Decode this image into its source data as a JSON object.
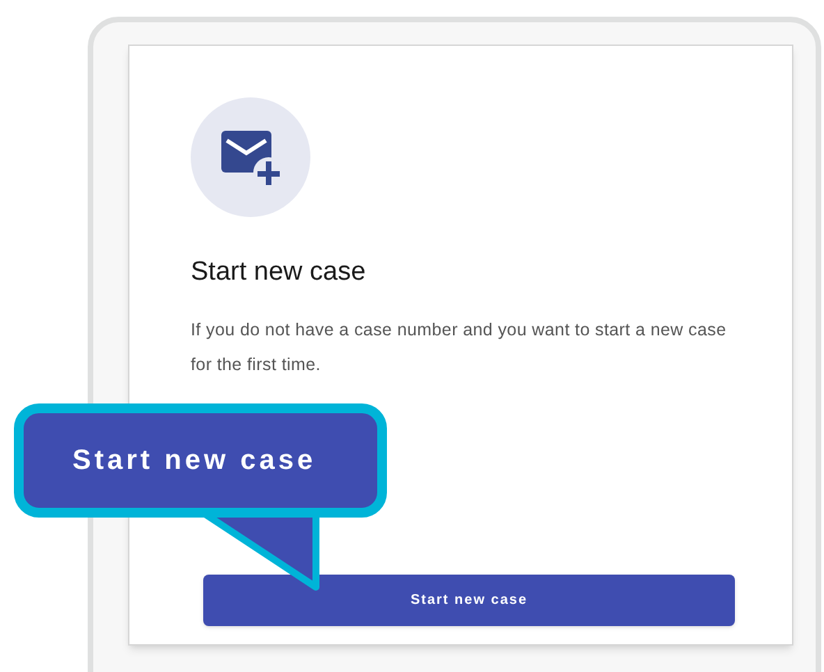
{
  "card": {
    "title": "Start new case",
    "description": "If you do not have a case number and you want to start a new case for the first time.",
    "button": "Start new case"
  },
  "callout": {
    "text": "Start new case"
  }
}
